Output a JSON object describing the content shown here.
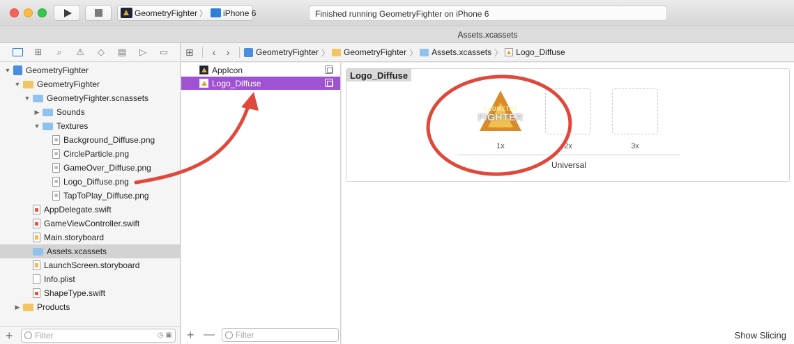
{
  "toolbar": {
    "scheme_target": "GeometryFighter",
    "scheme_device": "iPhone 6",
    "status": "Finished running GeometryFighter on iPhone 6"
  },
  "window": {
    "title": "Assets.xcassets"
  },
  "navigator": {
    "filter_placeholder": "Filter",
    "tree": [
      {
        "label": "GeometryFighter",
        "icon": "project-icon",
        "depth": 0,
        "disclosure": "▼"
      },
      {
        "label": "GeometryFighter",
        "icon": "folder-icon",
        "depth": 1,
        "disclosure": "▼"
      },
      {
        "label": "GeometryFighter.scnassets",
        "icon": "blue-folder-icon",
        "depth": 2,
        "disclosure": "▼"
      },
      {
        "label": "Sounds",
        "icon": "blue-folder-icon",
        "depth": 3,
        "disclosure": "▶"
      },
      {
        "label": "Textures",
        "icon": "blue-folder-icon",
        "depth": 3,
        "disclosure": "▼"
      },
      {
        "label": "Background_Diffuse.png",
        "icon": "png-file-icon",
        "depth": 4
      },
      {
        "label": "CircleParticle.png",
        "icon": "png-file-icon",
        "depth": 4
      },
      {
        "label": "GameOver_Diffuse.png",
        "icon": "png-file-icon",
        "depth": 4
      },
      {
        "label": "Logo_Diffuse.png",
        "icon": "png-file-icon",
        "depth": 4
      },
      {
        "label": "TapToPlay_Diffuse.png",
        "icon": "png-file-icon",
        "depth": 4
      },
      {
        "label": "AppDelegate.swift",
        "icon": "swift-file-icon",
        "depth": 2
      },
      {
        "label": "GameViewController.swift",
        "icon": "swift-file-icon",
        "depth": 2
      },
      {
        "label": "Main.storyboard",
        "icon": "storyboard-file-icon",
        "depth": 2
      },
      {
        "label": "Assets.xcassets",
        "icon": "xcassets-icon",
        "depth": 2,
        "selected": true
      },
      {
        "label": "LaunchScreen.storyboard",
        "icon": "storyboard-file-icon",
        "depth": 2
      },
      {
        "label": "Info.plist",
        "icon": "plist-file-icon",
        "depth": 2
      },
      {
        "label": "ShapeType.swift",
        "icon": "swift-file-icon",
        "depth": 2
      },
      {
        "label": "Products",
        "icon": "folder-icon",
        "depth": 1,
        "disclosure": "▶"
      }
    ]
  },
  "jumpbar": {
    "crumbs": [
      "GeometryFighter",
      "GeometryFighter",
      "Assets.xcassets",
      "Logo_Diffuse"
    ]
  },
  "assets": {
    "items": [
      {
        "label": "AppIcon",
        "selected": false
      },
      {
        "label": "Logo_Diffuse",
        "selected": true
      }
    ],
    "filter_placeholder": "Filter"
  },
  "editor": {
    "set_name": "Logo_Diffuse",
    "logo_line1": "GEOMETRY",
    "logo_line2": "FIGHTER",
    "slots": [
      "1x",
      "2x",
      "3x"
    ],
    "idiom": "Universal",
    "show_slicing": "Show Slicing"
  },
  "colors": {
    "selection_purple": "#9f52d1",
    "annotation_red": "#e0483c",
    "accent_blue": "#1e74e8"
  }
}
